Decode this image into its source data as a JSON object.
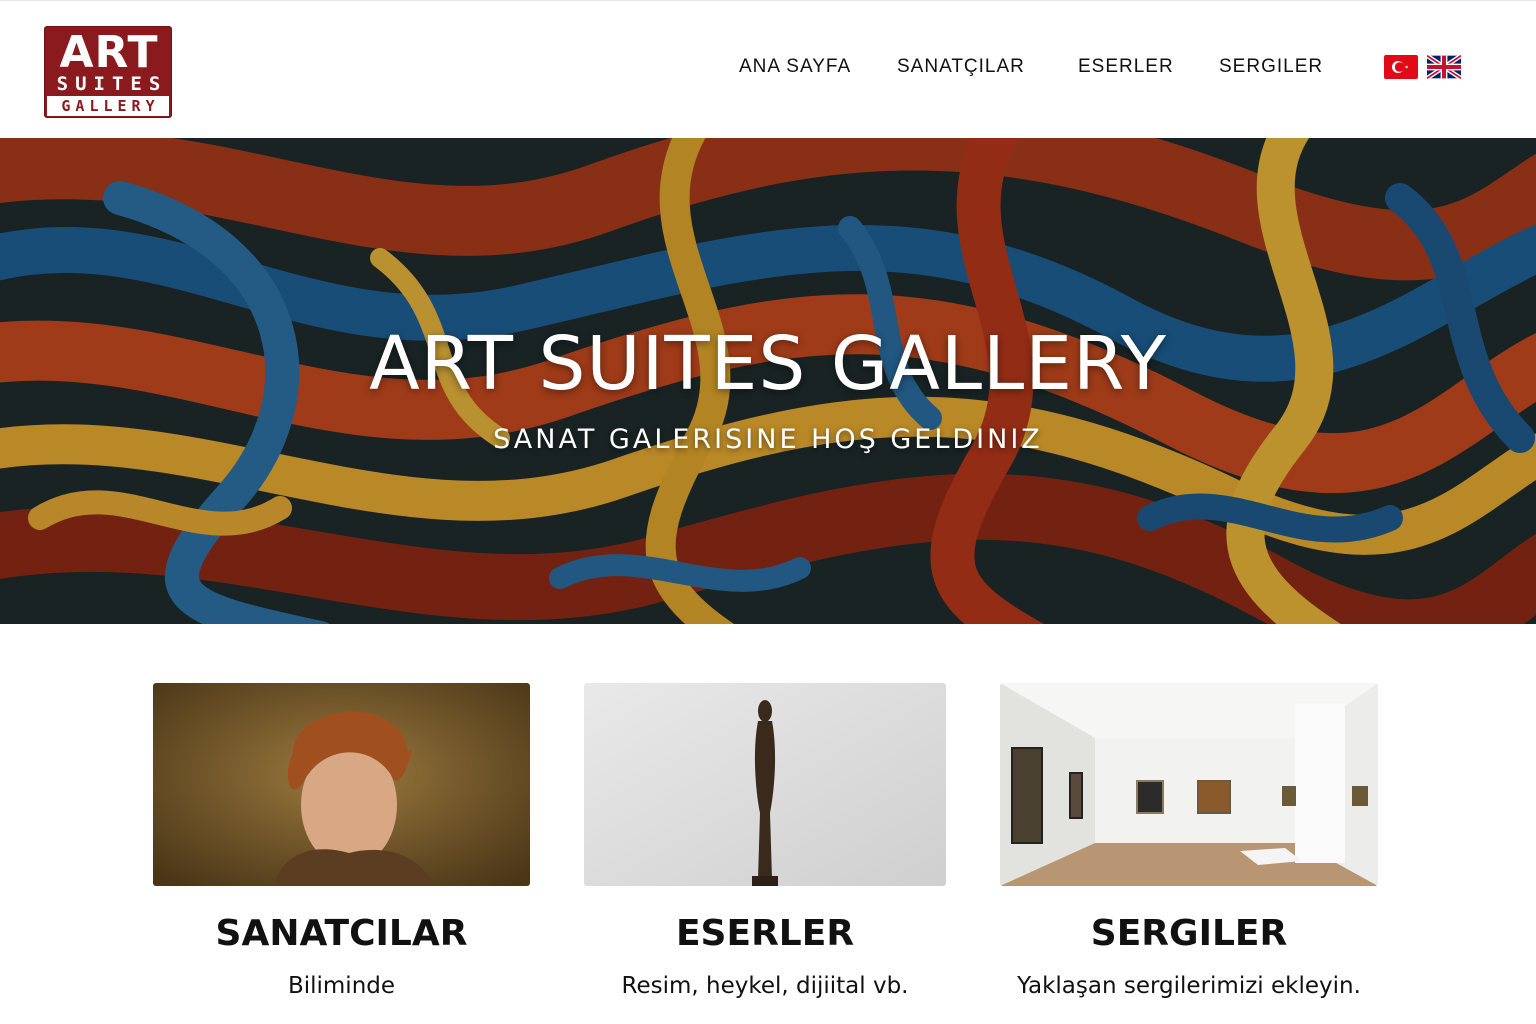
{
  "header": {
    "logo": {
      "line1": "ART",
      "line2": "SUITES",
      "line3": "GALLERY"
    },
    "nav": [
      {
        "label": "ANA SAYFA"
      },
      {
        "label": "SANATÇILAR"
      },
      {
        "label": "ESERLER"
      },
      {
        "label": "SERGILER"
      }
    ],
    "languages": [
      {
        "icon": "turkey-flag-icon"
      },
      {
        "icon": "uk-flag-icon"
      }
    ]
  },
  "hero": {
    "title": "ART SUITES GALLERY",
    "subtitle": "SANAT GALERISINE HOŞ GELDINIZ",
    "background": "abstract swirling oil painting in red, blue, yellow and dark teal"
  },
  "cards": [
    {
      "title": "SANATCILAR",
      "description": "Biliminde",
      "image": "portrait painting of a curly-haired young man"
    },
    {
      "title": "ESERLER",
      "description": "Resim, heykel, dijiital vb.",
      "image": "slender bronze figure sculpture"
    },
    {
      "title": "SERGILER",
      "description": "Yaklaşan sergilerimizi ekleyin.",
      "image": "white gallery room with framed paintings"
    }
  ],
  "colors": {
    "brand": "#8b1a1f",
    "text": "#111111",
    "background": "#ffffff"
  }
}
